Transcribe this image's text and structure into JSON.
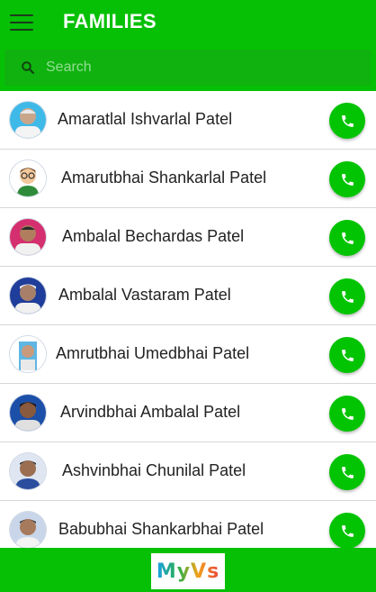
{
  "app": {
    "title": "FAMILIES",
    "menu_icon": "hamburger-menu-icon",
    "accent_color": "#05c005"
  },
  "search": {
    "placeholder": "Search",
    "value": "",
    "icon": "search-icon"
  },
  "families": [
    {
      "name": "Amaratlal Ishvarlal Patel",
      "avatar": "portrait-photo",
      "call_icon": "phone-icon"
    },
    {
      "name": "Amarutbhai Shankarlal Patel",
      "avatar": "cartoon-avatar",
      "call_icon": "phone-icon"
    },
    {
      "name": "Ambalal Bechardas Patel",
      "avatar": "portrait-photo",
      "call_icon": "phone-icon"
    },
    {
      "name": "Ambalal Vastaram Patel",
      "avatar": "portrait-photo",
      "call_icon": "phone-icon"
    },
    {
      "name": "Amrutbhai Umedbhai Patel",
      "avatar": "portrait-photo",
      "call_icon": "phone-icon"
    },
    {
      "name": "Arvindbhai Ambalal Patel",
      "avatar": "portrait-photo",
      "call_icon": "phone-icon"
    },
    {
      "name": "Ashvinbhai Chunilal Patel",
      "avatar": "portrait-photo",
      "call_icon": "phone-icon"
    },
    {
      "name": "Babubhai Shankarbhai Patel",
      "avatar": "portrait-photo",
      "call_icon": "phone-icon"
    }
  ],
  "footer": {
    "logo_text": "MyVs"
  }
}
